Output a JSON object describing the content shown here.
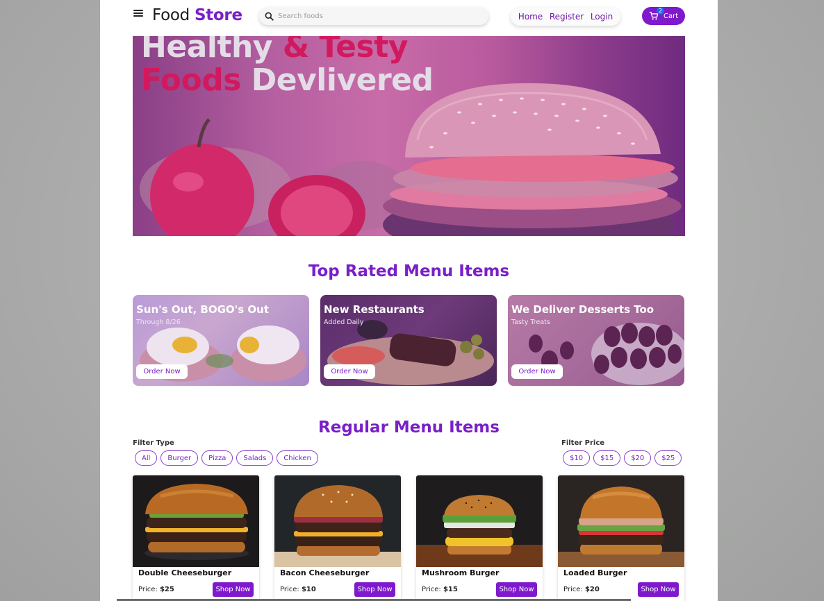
{
  "nav": {
    "brand_plain": "Food",
    "brand_accent": "Store",
    "search_placeholder": "Search foods",
    "links": [
      "Home",
      "Register",
      "Login"
    ],
    "cart_label": "Cart",
    "cart_count": "2"
  },
  "hero": {
    "line1_a": "Healthy",
    "line1_b": "& Testy",
    "line2_a": "Foods",
    "line2_b": "Devlivered"
  },
  "top_rated": {
    "title": "Top Rated Menu Items",
    "promos": [
      {
        "title": "Sun's Out, BOGO's Out",
        "subtitle": "Through 8/26",
        "button": "Order Now"
      },
      {
        "title": "New Restaurants",
        "subtitle": "Added Daily",
        "button": "Order Now"
      },
      {
        "title": "We Deliver Desserts Too",
        "subtitle": "Tasty Treats",
        "button": "Order Now"
      }
    ]
  },
  "regular": {
    "title": "Regular Menu Items",
    "filter_type_label": "Filter Type",
    "filter_types": [
      "All",
      "Burger",
      "Pizza",
      "Salads",
      "Chicken"
    ],
    "filter_price_label": "Filter Price",
    "filter_prices": [
      "$10",
      "$15",
      "$20",
      "$25"
    ],
    "price_label": "Price:",
    "items": [
      {
        "name": "Double Cheeseburger",
        "price": "$25",
        "button": "Shop Now"
      },
      {
        "name": "Bacon Cheeseburger",
        "price": "$10",
        "button": "Shop Now"
      },
      {
        "name": "Mushroom Burger",
        "price": "$15",
        "button": "Shop Now"
      },
      {
        "name": "Loaded Burger",
        "price": "$20",
        "button": "Shop Now"
      }
    ]
  },
  "colors": {
    "accent": "#7a1fc8",
    "hero_red": "#d2195e"
  }
}
